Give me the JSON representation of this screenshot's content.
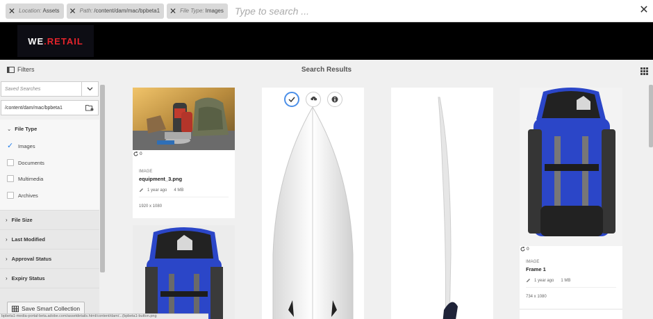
{
  "omnisearch": {
    "tags": [
      {
        "key": "Location:",
        "value": "Assets"
      },
      {
        "key": "Path:",
        "value": "/content/dam/mac/bpbeta1"
      },
      {
        "key": "File Type:",
        "value": "Images"
      }
    ],
    "placeholder": "Type to search ..."
  },
  "brand": {
    "logo_left": "WE",
    "logo_dot": ".",
    "logo_right": "RETAIL"
  },
  "toolbar": {
    "filters_label": "Filters",
    "title": "Search Results"
  },
  "rail": {
    "saved_searches_placeholder": "Saved Searches",
    "path_value": "/content/dam/mac/bpbeta1",
    "file_type": {
      "heading": "File Type",
      "options": [
        {
          "label": "Images",
          "checked": true
        },
        {
          "label": "Documents",
          "checked": false
        },
        {
          "label": "Multimedia",
          "checked": false
        },
        {
          "label": "Archives",
          "checked": false
        }
      ]
    },
    "sections": [
      "File Size",
      "Last Modified",
      "Approval Status",
      "Expiry Status"
    ],
    "save_smart_label": "Save Smart Collection"
  },
  "status_url": "bpbeta1-media-portal-beta.adobe.com/assetdetails.html/content/dam/...(bpbeta1-button.png",
  "results": {
    "cards": [
      {
        "type": "IMAGE",
        "name": "equipment_3.png",
        "modified": "1 year ago",
        "size": "4 MB",
        "dims": "1920 x 1080",
        "sync_count": "0"
      },
      {
        "type": "IMAGE",
        "name": "Frame 1",
        "modified": "1 year ago",
        "size": "1 MB",
        "dims": "734 x 1080",
        "sync_count": "0"
      }
    ]
  },
  "colors": {
    "accent": "#2680eb",
    "brand_red": "#e3242b",
    "backpack_blue": "#2b46c8"
  }
}
